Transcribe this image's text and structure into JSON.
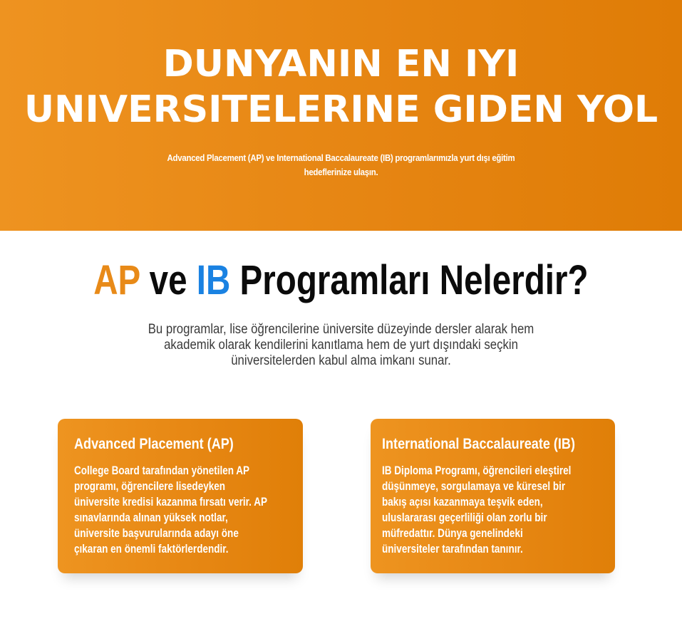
{
  "hero": {
    "title_line1": "DUNYANIN EN IYI",
    "title_line2": "UNIVERSITELERINE GIDEN YOL",
    "subtitle": "Advanced Placement (AP) ve International Baccalaureate (IB) programlarımızla yurt dışı eğitim hedeflerinize ulaşın."
  },
  "section": {
    "title_ap": "AP",
    "title_ve": "ve",
    "title_ib": "IB",
    "title_rest": "Programları Nelerdir?",
    "description": "Bu programlar, lise öğrencilerine üniversite düzeyinde dersler alarak hem akademik olarak kendilerini kanıtlama hem de yurt dışındaki seçkin üniversitelerden kabul alma imkanı sunar."
  },
  "cards": [
    {
      "title": "Advanced Placement (AP)",
      "text": "College Board tarafından yönetilen AP programı, öğrencilere lisedeyken üniversite kredisi kazanma fırsatı verir. AP sınavlarında alınan yüksek notlar, üniversite başvurularında adayı öne çıkaran en önemli faktörlerdendir."
    },
    {
      "title": "International Baccalaureate (IB)",
      "text": "IB Diploma Programı, öğrencileri eleştirel düşünmeye, sorgulamaya ve küresel bir bakış açısı kazanmaya teşvik eden, uluslararası geçerliliği olan zorlu bir müfredattır. Dünya genelindeki üniversiteler tarafından tanınır."
    }
  ],
  "colors": {
    "brand_orange": "#e68512",
    "accent_blue": "#1a82e2"
  }
}
